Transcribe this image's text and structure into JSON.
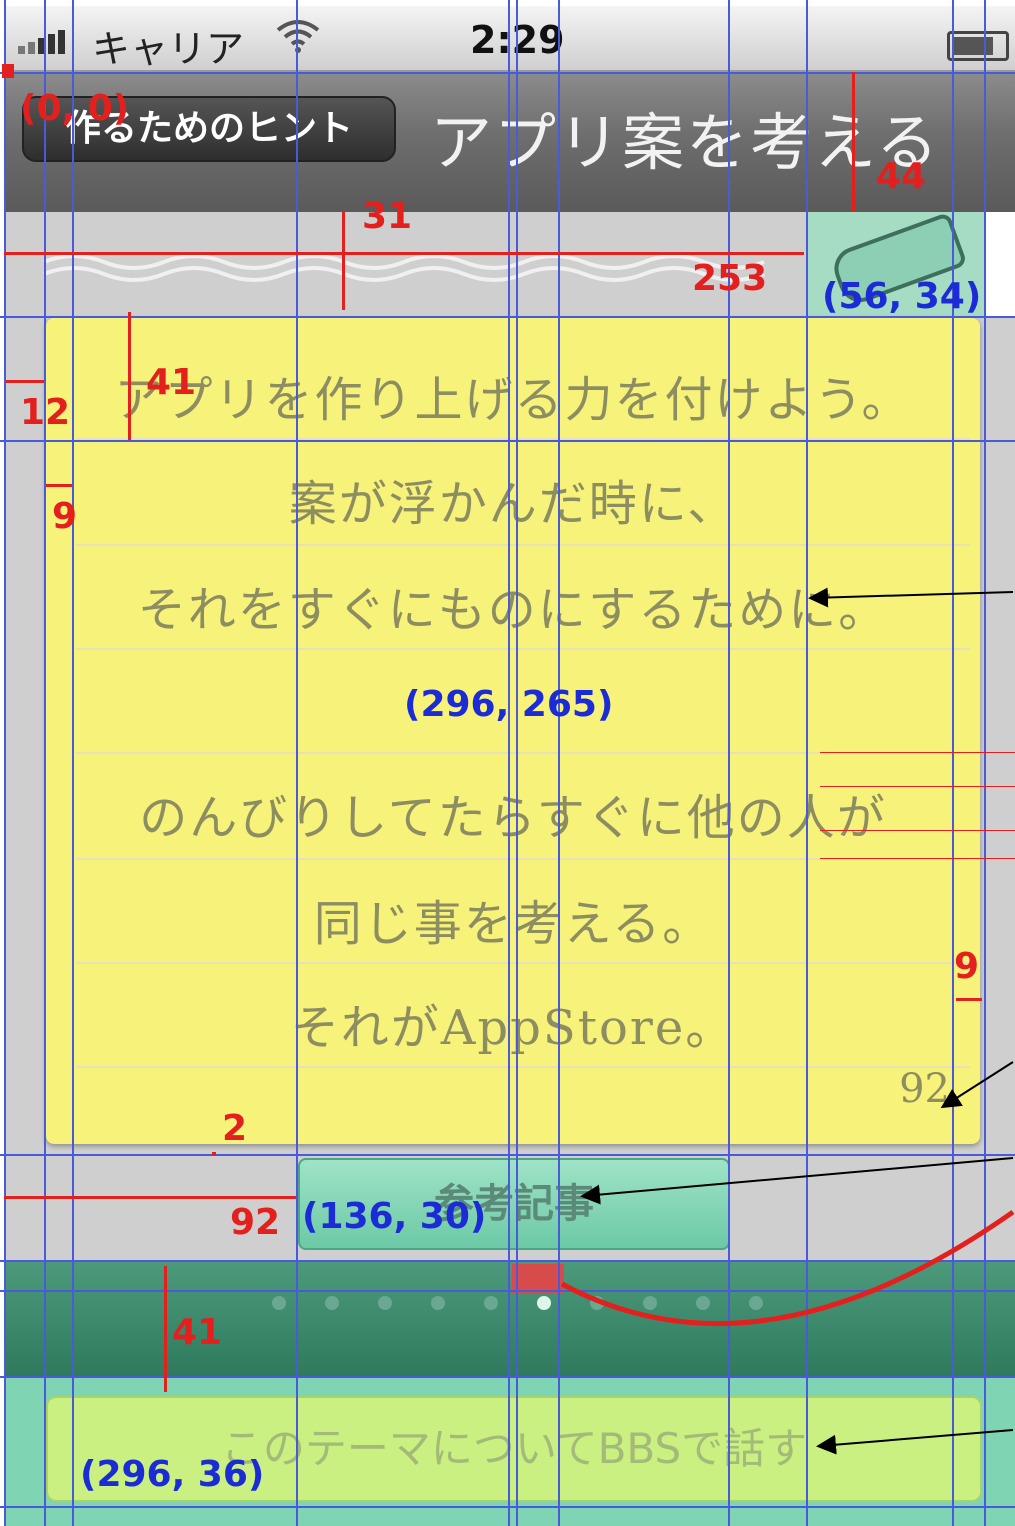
{
  "status_bar": {
    "carrier": "キャリア",
    "time": "2:29"
  },
  "nav": {
    "back_label": "作るためのヒント",
    "title": "アプリ案を考える"
  },
  "memo": {
    "lines": [
      "アプリを作り上げる力を付けよう。",
      "案が浮かんだ時に、",
      "それをすぐにものにするために。",
      "",
      "のんびりしてたらすぐに他の人が",
      "同じ事を考える。",
      "それがAppStore。"
    ],
    "page_number": "92"
  },
  "reference_button": {
    "label": "参考記事"
  },
  "page_control": {
    "total_dots": 10,
    "current_index": 5
  },
  "bbs_button": {
    "label": "このテーマについてBBSで話す"
  },
  "annotations": {
    "origin": "(0, 0)",
    "nav_height": "44",
    "strip_height": "31",
    "strip_width": "253",
    "icon_size": "(56, 34)",
    "text_line_height": "41",
    "margin_left": "12",
    "inner_margin": "9",
    "memo_size": "(296, 265)",
    "right_margin": "9",
    "gap": "2",
    "button_offset": "92",
    "button_size": "(136, 30)",
    "pager_height": "41",
    "bottom_button_size": "(296, 36)"
  },
  "colors": {
    "memo_yellow": "#f6f27a",
    "teal_button": "#7dd6b4",
    "guide_blue": "#4a5bd8",
    "annotation_red": "#e3201e"
  }
}
